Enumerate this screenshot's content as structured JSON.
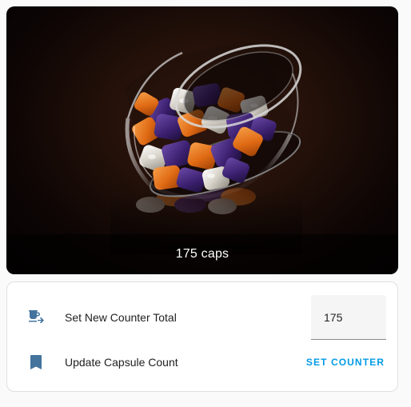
{
  "picture": {
    "caption": "175 caps"
  },
  "entities": {
    "row1": {
      "icon": "coffee-to-go-icon",
      "label": "Set New Counter Total",
      "value": "175"
    },
    "row2": {
      "icon": "bookmark-icon",
      "label": "Update Capsule Count",
      "button_label": "SET COUNTER"
    }
  },
  "colors": {
    "icon": "#44739e",
    "accent": "#039be5",
    "capsule_orange": "#e8721c",
    "capsule_purple": "#3a1f6e",
    "capsule_silver": "#d8d4cc"
  }
}
